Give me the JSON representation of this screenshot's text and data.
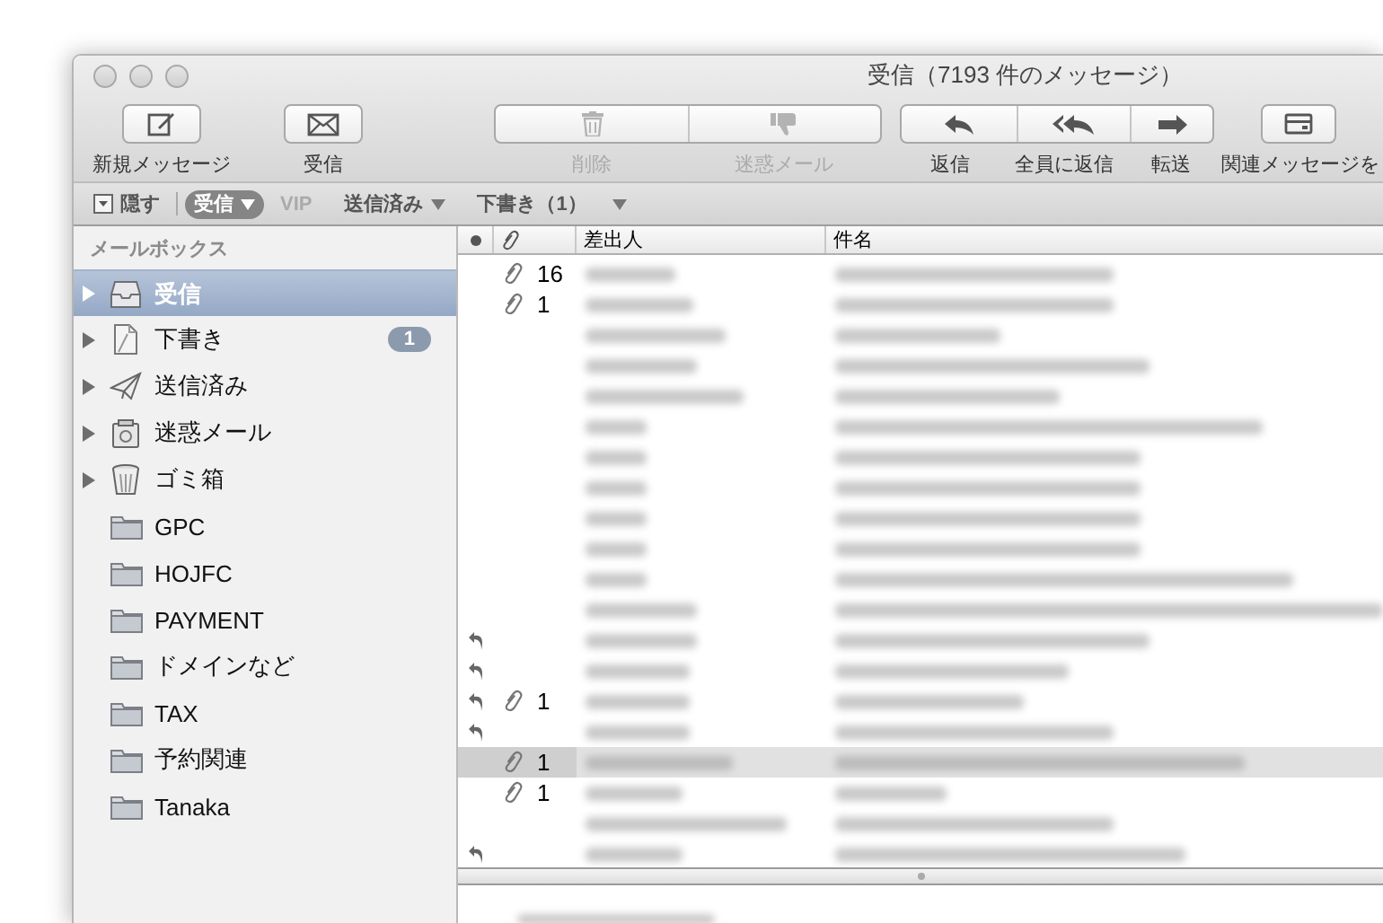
{
  "window": {
    "title": "受信（7193 件のメッセージ）"
  },
  "toolbar": [
    {
      "buttons": [
        {
          "label": "新規メッセージ",
          "disabled": false
        }
      ]
    },
    {
      "buttons": [
        {
          "label": "受信",
          "disabled": false
        }
      ]
    },
    {
      "buttons": [
        {
          "label": "削除",
          "disabled": true
        },
        {
          "label": "迷惑メール",
          "disabled": true
        }
      ]
    },
    {
      "buttons": [
        {
          "label": "返信",
          "disabled": false
        },
        {
          "label": "全員に返信",
          "disabled": false
        },
        {
          "label": "転送",
          "disabled": false
        }
      ]
    },
    {
      "buttons": [
        {
          "label": "関連メッセージを",
          "disabled": false
        }
      ]
    }
  ],
  "favorites_bar": {
    "hide_button": {
      "label": "隠す"
    },
    "items": [
      {
        "label": "受信",
        "selected": true,
        "disabled": false,
        "has_menu": true
      },
      {
        "label": "VIP",
        "selected": false,
        "disabled": true,
        "has_menu": false
      },
      {
        "label": "送信済み",
        "selected": false,
        "disabled": false,
        "has_menu": true
      },
      {
        "label": "下書き（1）",
        "selected": false,
        "disabled": false,
        "has_menu": true
      }
    ]
  },
  "sidebar": {
    "heading": "メールボックス",
    "items": [
      {
        "kind": "inbox",
        "label": "受信",
        "selected": true,
        "expandable": true
      },
      {
        "kind": "drafts",
        "label": "下書き",
        "selected": false,
        "expandable": true,
        "badge": "1"
      },
      {
        "kind": "sent",
        "label": "送信済み",
        "selected": false,
        "expandable": true
      },
      {
        "kind": "junk",
        "label": "迷惑メール",
        "selected": false,
        "expandable": true
      },
      {
        "kind": "trash",
        "label": "ゴミ箱",
        "selected": false,
        "expandable": true
      },
      {
        "kind": "folder",
        "label": "GPC",
        "selected": false,
        "expandable": false
      },
      {
        "kind": "folder",
        "label": "HOJFC",
        "selected": false,
        "expandable": false
      },
      {
        "kind": "folder",
        "label": "PAYMENT",
        "selected": false,
        "expandable": false
      },
      {
        "kind": "folder",
        "label": "ドメインなど",
        "selected": false,
        "expandable": false
      },
      {
        "kind": "folder",
        "label": "TAX",
        "selected": false,
        "expandable": false
      },
      {
        "kind": "folder",
        "label": "予約関連",
        "selected": false,
        "expandable": false
      },
      {
        "kind": "folder",
        "label": "Tanaka",
        "selected": false,
        "expandable": false
      }
    ]
  },
  "message_list": {
    "columns": [
      "差出人",
      "件名"
    ],
    "rows": [
      {
        "replied": false,
        "attachments": "16",
        "selected": false
      },
      {
        "replied": false,
        "attachments": "1",
        "selected": false
      },
      {
        "replied": false,
        "selected": false
      },
      {
        "replied": false,
        "selected": false
      },
      {
        "replied": false,
        "selected": false
      },
      {
        "replied": false,
        "selected": false
      },
      {
        "replied": false,
        "selected": false
      },
      {
        "replied": false,
        "selected": false
      },
      {
        "replied": false,
        "selected": false
      },
      {
        "replied": false,
        "selected": false
      },
      {
        "replied": false,
        "selected": false
      },
      {
        "replied": false,
        "selected": false
      },
      {
        "replied": true,
        "selected": false
      },
      {
        "replied": true,
        "selected": false
      },
      {
        "replied": true,
        "attachments": "1",
        "selected": false
      },
      {
        "replied": true,
        "selected": false
      },
      {
        "replied": false,
        "attachments": "1",
        "selected": true
      },
      {
        "replied": false,
        "attachments": "1",
        "selected": false
      },
      {
        "replied": false,
        "selected": false
      },
      {
        "replied": true,
        "selected": false
      }
    ]
  }
}
